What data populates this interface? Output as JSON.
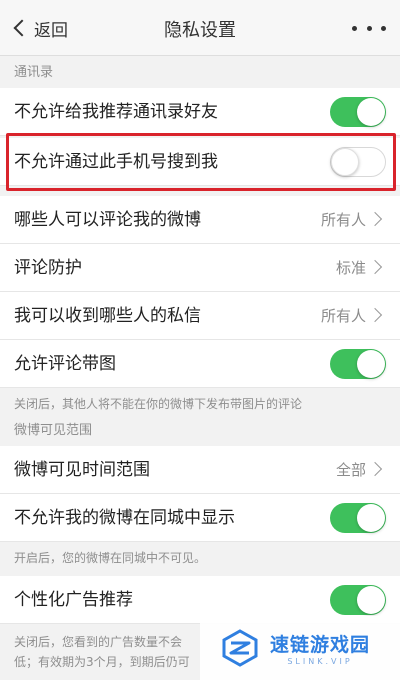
{
  "navbar": {
    "back_label": "返回",
    "title": "隐私设置"
  },
  "sections": {
    "contacts_header": "通讯录",
    "visibility_header": "微博可见范围"
  },
  "rows": {
    "no_recommend_contacts": {
      "label": "不允许给我推荐通讯录好友",
      "toggle": "on"
    },
    "no_search_by_phone": {
      "label": "不允许通过此手机号搜到我",
      "toggle": "off"
    },
    "who_can_comment": {
      "label": "哪些人可以评论我的微博",
      "value": "所有人"
    },
    "comment_protection": {
      "label": "评论防护",
      "value": "标准"
    },
    "who_can_message": {
      "label": "我可以收到哪些人的私信",
      "value": "所有人"
    },
    "allow_comment_images": {
      "label": "允许评论带图",
      "toggle": "on"
    },
    "visible_time_range": {
      "label": "微博可见时间范围",
      "value": "全部"
    },
    "hide_in_local": {
      "label": "不允许我的微博在同城中显示",
      "toggle": "on"
    },
    "personalized_ads": {
      "label": "个性化广告推荐",
      "toggle": "on"
    }
  },
  "notes": {
    "comment_images_note": "关闭后，其他人将不能在你的微博下发布带图片的评论",
    "local_note": "开启后，您的微博在同城中不可见。",
    "ads_note_line1": "关闭后，您看到的广告数量不会",
    "ads_note_line2": "低；有效期为3个月，到期后仍可"
  },
  "watermark": {
    "cn": "速链游戏园",
    "en": "SLINK.VIP"
  },
  "colors": {
    "toggle_on": "#3ec05c",
    "highlight": "#d9232b",
    "brand": "#2f7fe0"
  }
}
